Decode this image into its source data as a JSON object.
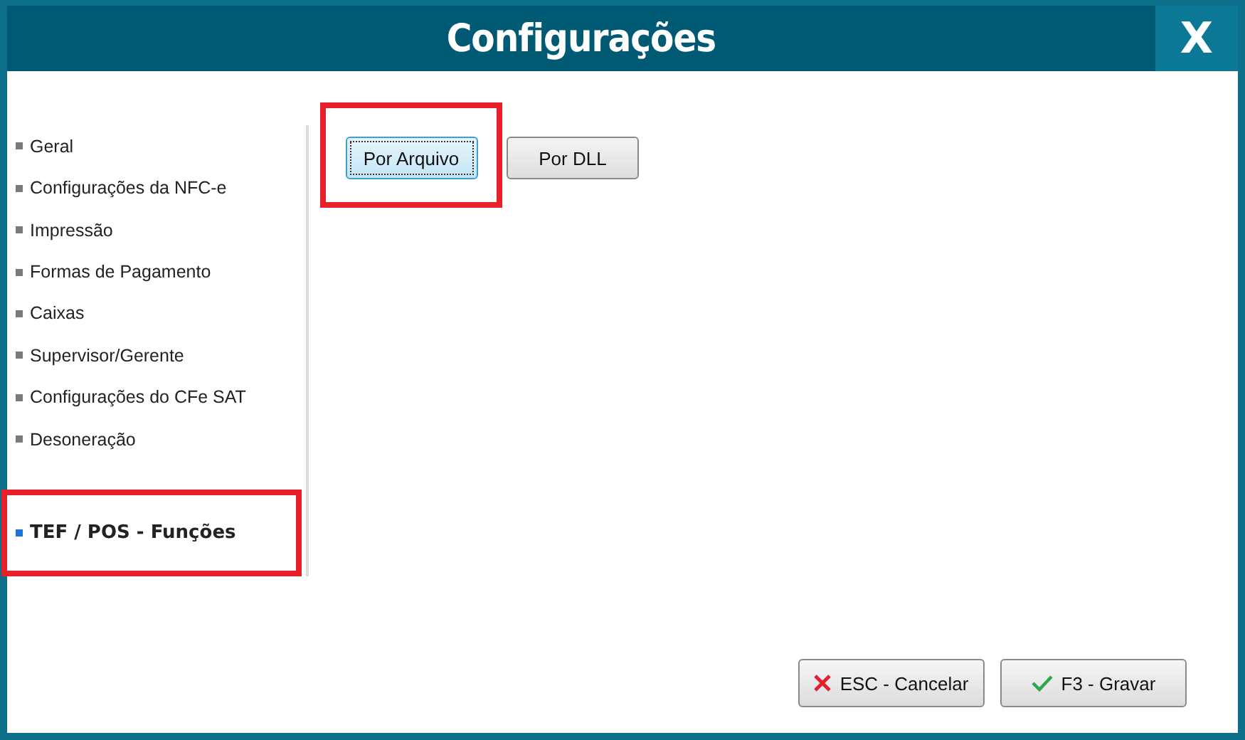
{
  "window": {
    "title": "Configurações",
    "close": "X"
  },
  "sidebar": {
    "items": [
      {
        "label": "Geral",
        "selected": false,
        "highlighted": false
      },
      {
        "label": "Configurações da NFC-e",
        "selected": false,
        "highlighted": false
      },
      {
        "label": "Impressão",
        "selected": false,
        "highlighted": false
      },
      {
        "label": "Formas de Pagamento",
        "selected": false,
        "highlighted": false
      },
      {
        "label": "Caixas",
        "selected": false,
        "highlighted": false
      },
      {
        "label": "Supervisor/Gerente",
        "selected": false,
        "highlighted": false
      },
      {
        "label": "Configurações do CFe SAT",
        "selected": false,
        "highlighted": false
      },
      {
        "label": "Desoneração",
        "selected": false,
        "highlighted": false
      },
      {
        "label": "TEF / POS - Funções",
        "selected": true,
        "highlighted": true
      }
    ]
  },
  "options": [
    {
      "label": "Por Arquivo",
      "focused": true,
      "highlighted": true
    },
    {
      "label": "Por DLL",
      "focused": false,
      "highlighted": false
    }
  ],
  "footer": [
    {
      "label": "ESC - Cancelar",
      "kind": "cancel"
    },
    {
      "label": "F3 - Gravar",
      "kind": "save"
    }
  ]
}
